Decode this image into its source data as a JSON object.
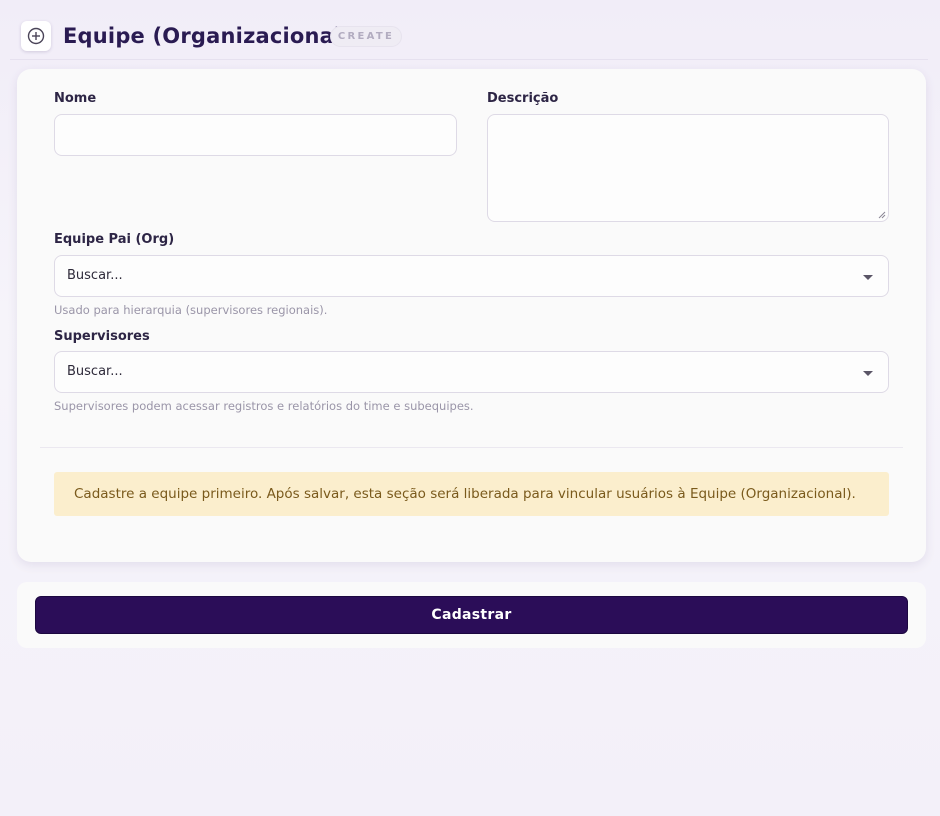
{
  "header": {
    "icon": "add-circle-icon",
    "title": "Equipe (Organizacional)",
    "mode_badge": "CREATE"
  },
  "form": {
    "nome": {
      "label": "Nome",
      "value": ""
    },
    "descricao": {
      "label": "Descrição",
      "value": ""
    },
    "equipe_pai": {
      "label": "Equipe Pai (Org)",
      "placeholder": "Buscar...",
      "help": "Usado para hierarquia (supervisores regionais)."
    },
    "supervisores": {
      "label": "Supervisores",
      "placeholder": "Buscar...",
      "help": "Supervisores podem acessar registros e relatórios do time e subequipes."
    },
    "notice": "Cadastre a equipe primeiro. Após salvar, esta seção será liberada para vincular usuários à Equipe (Organizacional)."
  },
  "actions": {
    "submit_label": "Cadastrar"
  },
  "colors": {
    "primary": "#2b0d58",
    "title": "#2a1b52",
    "notice_bg": "#fbeecd",
    "notice_text": "#7a5a1c"
  }
}
